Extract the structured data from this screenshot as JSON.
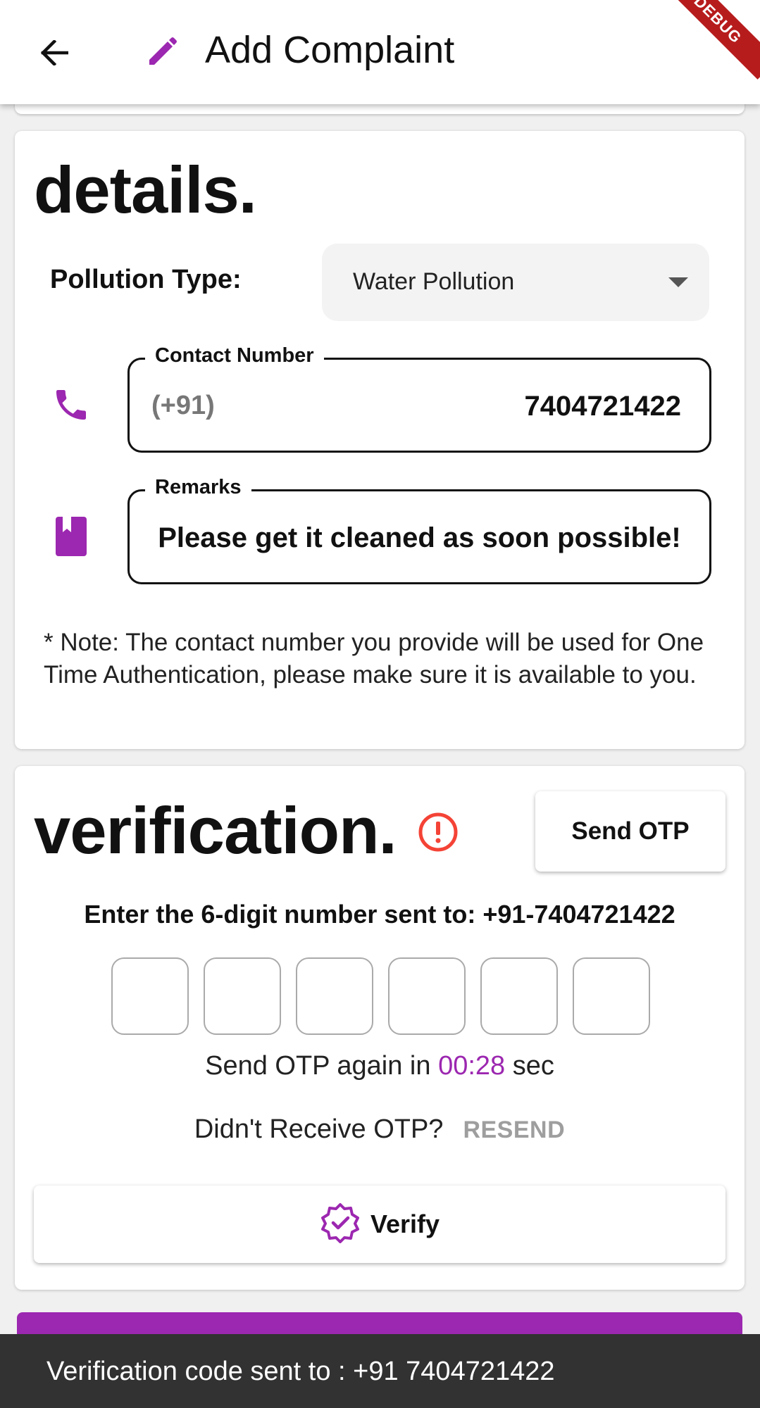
{
  "appbar": {
    "title": "Add Complaint",
    "back_icon": "arrow-back-icon",
    "title_icon": "pencil-icon",
    "debug_banner": "DEBUG"
  },
  "details": {
    "heading": "details.",
    "pollution_type_label": "Pollution Type:",
    "pollution_type_value": "Water Pollution",
    "contact": {
      "label": "Contact Number",
      "prefix": "(+91)",
      "value": "7404721422",
      "icon": "phone-icon"
    },
    "remarks": {
      "label": "Remarks",
      "value": "Please get it cleaned as soon possible!",
      "icon": "book-icon"
    },
    "note": "* Note: The contact number you provide will be used for One Time Authentication, please make sure it is available to you."
  },
  "verification": {
    "heading": "verification.",
    "status_icon": "error-outline-icon",
    "send_otp_label": "Send OTP",
    "enter_text": "Enter the 6-digit number sent to: +91-7404721422",
    "otp_digits": [
      "",
      "",
      "",
      "",
      "",
      ""
    ],
    "timer_prefix": "Send OTP again in ",
    "timer_value": "00:28",
    "timer_suffix": " sec",
    "not_received_text": "Didn't Receive OTP?",
    "resend_label": "RESEND",
    "verify_label": "Verify",
    "verify_icon": "verified-badge-icon"
  },
  "snackbar": {
    "message": "Verification code sent to : +91 7404721422"
  },
  "colors": {
    "accent": "#9c27b0",
    "alert": "#f44336",
    "snackbar_bg": "#323232"
  }
}
